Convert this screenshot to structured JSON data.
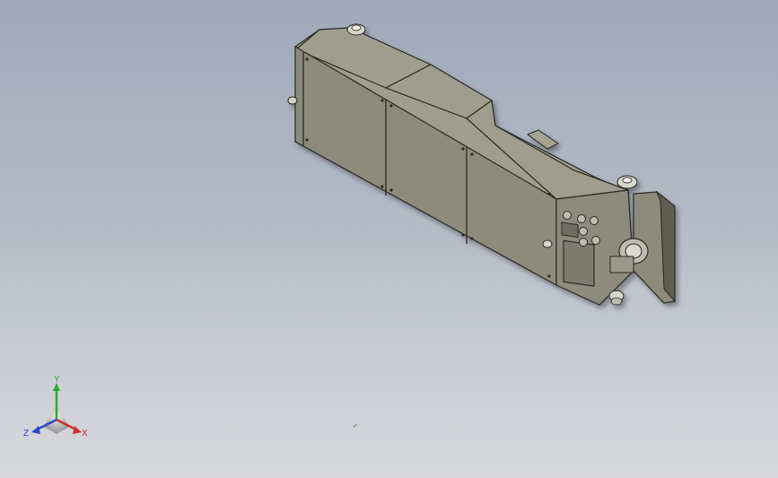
{
  "viewport": {
    "background_top": "#9fa9b9",
    "background_bottom": "#d8d9dd"
  },
  "model": {
    "body_color": "#8c8b7b",
    "top_color": "#9f9e8e",
    "dark_color": "#5e5d50",
    "edge_color": "#2a2a24"
  },
  "triad": {
    "x_label": "X",
    "y_label": "Y",
    "z_label": "Z",
    "x_color": "#d0312d",
    "y_color": "#2fa836",
    "z_color": "#2c46c8"
  }
}
